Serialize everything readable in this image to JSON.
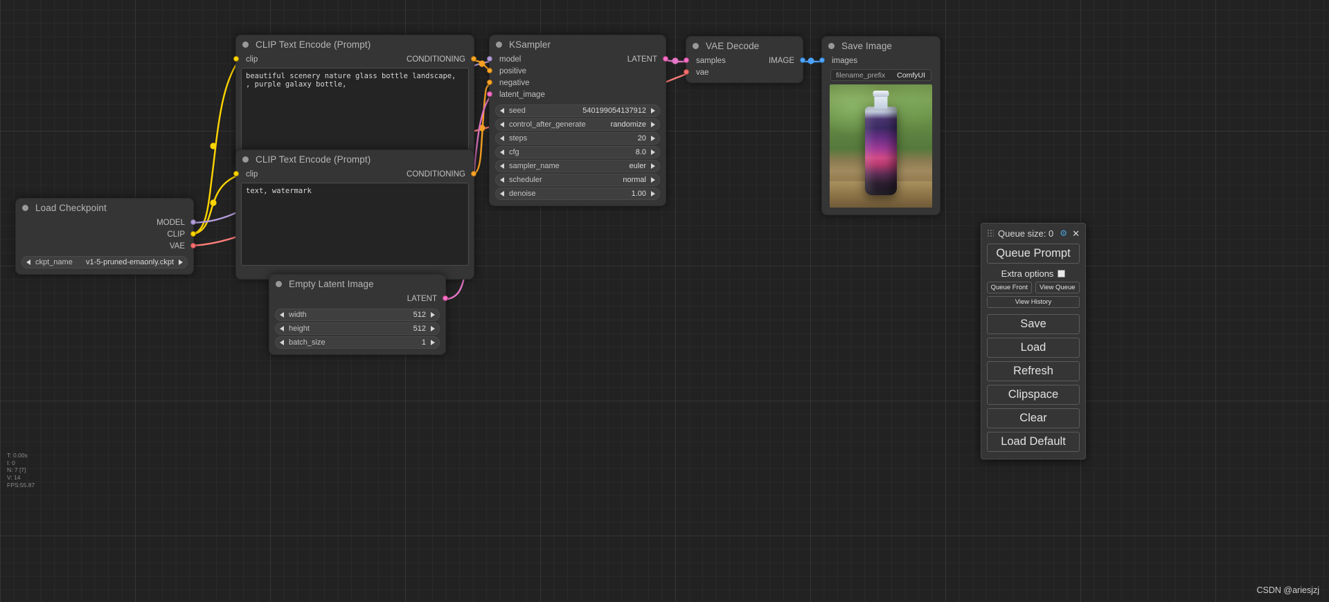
{
  "app": {
    "name": "ComfyUI",
    "watermark": "CSDN @ariesjzj"
  },
  "nodes": {
    "load_checkpoint": {
      "title": "Load Checkpoint",
      "outputs": [
        {
          "label": "MODEL",
          "color": "#b39ddb"
        },
        {
          "label": "CLIP",
          "color": "#ffd500"
        },
        {
          "label": "VAE",
          "color": "#ff6e6e"
        }
      ],
      "widgets": [
        {
          "name": "ckpt_name",
          "value": "v1-5-pruned-emaonly.ckpt"
        }
      ]
    },
    "clip_positive": {
      "title": "CLIP Text Encode (Prompt)",
      "input": {
        "label": "clip",
        "color": "#ffd500"
      },
      "output": {
        "label": "CONDITIONING",
        "color": "#ffa726"
      },
      "text": "beautiful scenery nature glass bottle landscape, , purple galaxy bottle,"
    },
    "clip_negative": {
      "title": "CLIP Text Encode (Prompt)",
      "input": {
        "label": "clip",
        "color": "#ffd500"
      },
      "output": {
        "label": "CONDITIONING",
        "color": "#ffa726"
      },
      "text": "text, watermark"
    },
    "empty_latent": {
      "title": "Empty Latent Image",
      "output": {
        "label": "LATENT",
        "color": "#ff6ec7"
      },
      "widgets": [
        {
          "name": "width",
          "value": "512"
        },
        {
          "name": "height",
          "value": "512"
        },
        {
          "name": "batch_size",
          "value": "1"
        }
      ]
    },
    "ksampler": {
      "title": "KSampler",
      "inputs": [
        {
          "label": "model",
          "color": "#b39ddb"
        },
        {
          "label": "positive",
          "color": "#ffa726"
        },
        {
          "label": "negative",
          "color": "#ffa726"
        },
        {
          "label": "latent_image",
          "color": "#ff6ec7"
        }
      ],
      "outputs": [
        {
          "label": "LATENT",
          "color": "#ff6ec7"
        }
      ],
      "widgets": [
        {
          "name": "seed",
          "value": "540199054137912"
        },
        {
          "name": "control_after_generate",
          "value": "randomize"
        },
        {
          "name": "steps",
          "value": "20"
        },
        {
          "name": "cfg",
          "value": "8.0"
        },
        {
          "name": "sampler_name",
          "value": "euler"
        },
        {
          "name": "scheduler",
          "value": "normal"
        },
        {
          "name": "denoise",
          "value": "1.00"
        }
      ]
    },
    "vae_decode": {
      "title": "VAE Decode",
      "inputs": [
        {
          "label": "samples",
          "color": "#ff6ec7"
        },
        {
          "label": "vae",
          "color": "#ff6e6e"
        }
      ],
      "outputs": [
        {
          "label": "IMAGE",
          "color": "#4da6ff"
        }
      ]
    },
    "save_image": {
      "title": "Save Image",
      "inputs": [
        {
          "label": "images",
          "color": "#4da6ff"
        }
      ],
      "widgets": [
        {
          "name": "filename_prefix",
          "value": "ComfyUI"
        }
      ]
    }
  },
  "menu": {
    "queue_size_label": "Queue size: 0",
    "gear_icon": "gear-icon",
    "close_icon": "close-icon",
    "queue_prompt": "Queue Prompt",
    "extra_options": "Extra options",
    "queue_front": "Queue Front",
    "view_queue": "View Queue",
    "view_history": "View History",
    "save": "Save",
    "load": "Load",
    "refresh": "Refresh",
    "clipspace": "Clipspace",
    "clear": "Clear",
    "load_default": "Load Default"
  },
  "stats": {
    "time": "T: 0.00s",
    "iterations": "I: 0",
    "nodes": "N: 7 [7]",
    "vertices": "V: 14",
    "fps": "FPS:55.87"
  }
}
